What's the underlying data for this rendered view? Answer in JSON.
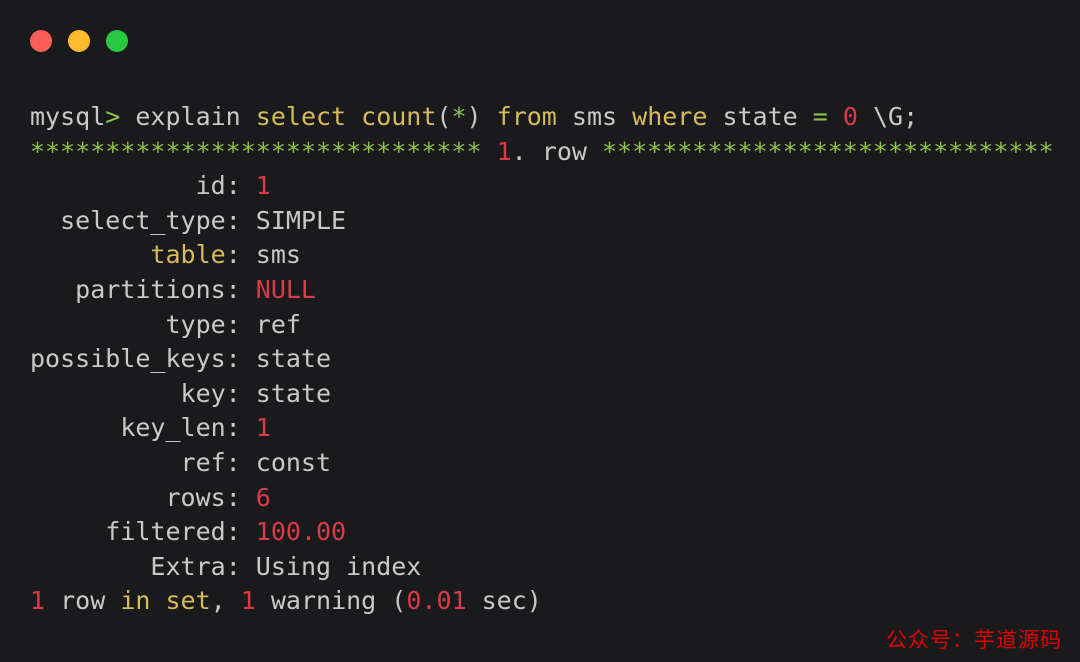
{
  "window": {
    "background_color": "#1a1a1c",
    "titlebar": {
      "buttons": [
        {
          "name": "close",
          "color": "#fc5f57",
          "label": ""
        },
        {
          "name": "minimize",
          "color": "#fdbc2e",
          "label": ""
        },
        {
          "name": "maximize",
          "color": "#28c840",
          "label": ""
        }
      ]
    }
  },
  "palette": {
    "foreground": "#c9c9c9",
    "yellow": "#d6bb5c",
    "green": "#8bc24a",
    "red": "#d93c48",
    "watermark_red": "#e00000"
  },
  "console": {
    "prompt": "mysql>",
    "command": "explain select count(*) from sms where state = 0 \\G;",
    "separator": {
      "left_stars": "******************************",
      "row_number": "1",
      "row_label": ". row ",
      "right_stars": "******************************"
    },
    "lines": [
      {
        "type": "command",
        "segments": [
          {
            "text": "mysql>",
            "color": "mixed-prompt"
          },
          {
            "text": " explain ",
            "color": "white"
          },
          {
            "text": "select ",
            "color": "yellow"
          },
          {
            "text": "count",
            "color": "yellow"
          },
          {
            "text": "(",
            "color": "white"
          },
          {
            "text": "*",
            "color": "green"
          },
          {
            "text": ") ",
            "color": "white"
          },
          {
            "text": "from ",
            "color": "yellow"
          },
          {
            "text": "sms ",
            "color": "white"
          },
          {
            "text": "where ",
            "color": "yellow"
          },
          {
            "text": "state ",
            "color": "white"
          },
          {
            "text": "= ",
            "color": "green"
          },
          {
            "text": "0",
            "color": "red"
          },
          {
            "text": " \\G;",
            "color": "white"
          }
        ]
      },
      {
        "type": "separator"
      },
      {
        "type": "field",
        "label": "id",
        "label_color": "white",
        "value": "1",
        "value_color": "red"
      },
      {
        "type": "field",
        "label": "select_type",
        "label_color": "white",
        "value": "SIMPLE",
        "value_color": "white"
      },
      {
        "type": "field",
        "label": "table",
        "label_color": "yellow",
        "value": "sms",
        "value_color": "white"
      },
      {
        "type": "field",
        "label": "partitions",
        "label_color": "white",
        "value": "NULL",
        "value_color": "red"
      },
      {
        "type": "field",
        "label": "type",
        "label_color": "white",
        "value": "ref",
        "value_color": "white"
      },
      {
        "type": "field",
        "label": "possible_keys",
        "label_color": "white",
        "value": "state",
        "value_color": "white"
      },
      {
        "type": "field",
        "label": "key",
        "label_color": "white",
        "value": "state",
        "value_color": "white"
      },
      {
        "type": "field",
        "label": "key_len",
        "label_color": "white",
        "value": "1",
        "value_color": "red"
      },
      {
        "type": "field",
        "label": "ref",
        "label_color": "white",
        "value": "const",
        "value_color": "white"
      },
      {
        "type": "field",
        "label": "rows",
        "label_color": "white",
        "value": "6",
        "value_color": "red"
      },
      {
        "type": "field",
        "label": "filtered",
        "label_color": "white",
        "value": "100.00",
        "value_color": "red"
      },
      {
        "type": "field",
        "label": "Extra",
        "label_color": "white",
        "value": "Using index",
        "value_color": "white"
      }
    ],
    "status_line": {
      "rows_count": "1",
      "rows_word": " row ",
      "in_set": "in set",
      "comma": ", ",
      "warning_count": "1",
      "warning_word": " warning ",
      "open_paren": "(",
      "duration": "0.01",
      "sec": " sec)"
    }
  },
  "watermark": {
    "text": "公众号：芋道源码"
  }
}
